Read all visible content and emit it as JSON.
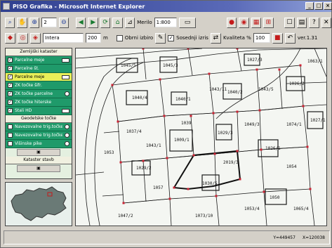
{
  "window": {
    "title": "PISO Grafika - Microsoft Internet Explorer",
    "controls": [
      "_",
      "□",
      "×"
    ]
  },
  "toolbar": {
    "zoom_value": "2",
    "merilo_label": "Merilo",
    "merilo_value": "1:800",
    "layer_value": "Intera",
    "radius_value": "200",
    "unit_label": "m",
    "obm_label": "Obrni izbiro",
    "sosed_label": "Sosednji izris",
    "kvaliteta_label": "Kvaliteta %",
    "kvaliteta_value": "100",
    "version": "ver.1.31"
  },
  "panel": {
    "header1": "Zemljiški kataster",
    "layers": [
      {
        "label": "Parcelne meje",
        "checked": true,
        "marker": "swatch"
      },
      {
        "label": "Parcelne št.",
        "checked": true,
        "marker": "none"
      },
      {
        "label": "Parcelne meje",
        "checked": true,
        "marker": "swatch",
        "highlight": true
      },
      {
        "label": "ZK točke šifr.",
        "checked": true,
        "marker": "none"
      },
      {
        "label": "ZK točke parcelne",
        "checked": true,
        "marker": "plus"
      },
      {
        "label": "ZK točke hiterske",
        "checked": true,
        "marker": "none"
      },
      {
        "label": "Stali HD",
        "checked": true,
        "marker": "swatch"
      }
    ],
    "header2": "Geodetske točke",
    "points": [
      {
        "label": "Navezovalne trig.točke",
        "marker": "dot"
      },
      {
        "label": "Navezovalne trig.točke",
        "marker": "dot"
      },
      {
        "label": "Višinske pike",
        "marker": "dot"
      }
    ],
    "header3": "Kataster stavb"
  },
  "map": {
    "labels": [
      "1045/5",
      "1045/3",
      "1040/4",
      "1040/1",
      "1040/2",
      "1009/1",
      "1029/3",
      "1029/2",
      "1030/5",
      "1026/1",
      "1026/2",
      "1027/1",
      "1027/3",
      "1037/4",
      "1039",
      "2019/3",
      "1050",
      "1049/3",
      "1054",
      "1053",
      "1057",
      "1053/4",
      "1065/4",
      "1047/2",
      "1073/10",
      "1074/1",
      "1043/11",
      "1043/5",
      "1043/1",
      "1063/1"
    ]
  },
  "status": {
    "y": "Y=449457",
    "x": "X=120038"
  },
  "colors": {
    "map_bg": "#f4f6f2",
    "parcel_line": "#1a1a1a",
    "vertex": "#cc2233",
    "panel_row": "#1f9a6a",
    "highlight": "#e8ef58"
  }
}
